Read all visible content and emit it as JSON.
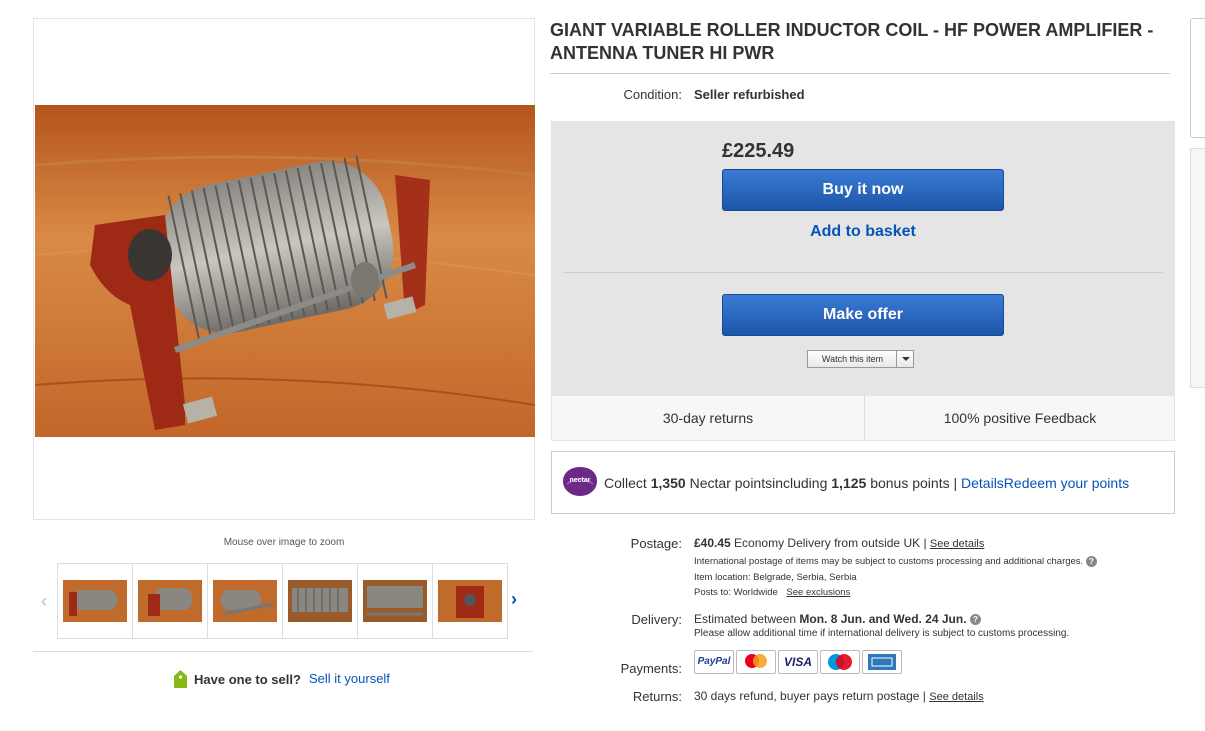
{
  "gallery": {
    "zoom_hint": "Mouse over image to zoom",
    "thumb_count": 6
  },
  "sell": {
    "prompt": "Have one to sell?",
    "link": "Sell it yourself"
  },
  "item": {
    "title": "GIANT VARIABLE ROLLER INDUCTOR COIL - HF POWER AMPLIFIER - ANTENNA TUNER HI PWR",
    "condition_label": "Condition:",
    "condition_value": "Seller refurbished"
  },
  "buybox": {
    "price": "£225.49",
    "buy_now": "Buy it now",
    "add_basket": "Add to basket",
    "make_offer": "Make offer",
    "watch": "Watch this item"
  },
  "features": {
    "returns": "30-day returns",
    "feedback": "100% positive Feedback"
  },
  "nectar": {
    "logo_text": "nectar",
    "collect": "Collect",
    "points": "1,350",
    "points_text": "Nectar pointsincluding",
    "bonus": "1,125",
    "bonus_text": "bonus points |",
    "details": "DetailsRedeem your points"
  },
  "shipping": {
    "postage_label": "Postage:",
    "postage_price": "£40.45",
    "postage_method": "Economy Delivery from outside UK |",
    "see_details": "See details",
    "intl_note": "International postage of items may be subject to customs processing and additional charges.",
    "location": "Item location:  Belgrade, Serbia, Serbia",
    "posts_to_label": "Posts to:  Worldwide",
    "see_exclusions": "See exclusions",
    "delivery_label": "Delivery:",
    "delivery_prefix": "Estimated between",
    "delivery_range": "Mon. 8 Jun. and Wed. 24 Jun.",
    "delivery_note": "Please allow additional time if international delivery is subject to customs processing.",
    "payments_label": "Payments:",
    "payment_methods": [
      "PayPal",
      "Mastercard",
      "VISA",
      "Maestro",
      "American Express"
    ],
    "returns_label": "Returns:",
    "returns_value": "30 days refund, buyer pays return postage |",
    "returns_details": "See details"
  },
  "colors": {
    "link": "#0654ba",
    "button": "#1d56a8",
    "nectar": "#6c2a86"
  }
}
